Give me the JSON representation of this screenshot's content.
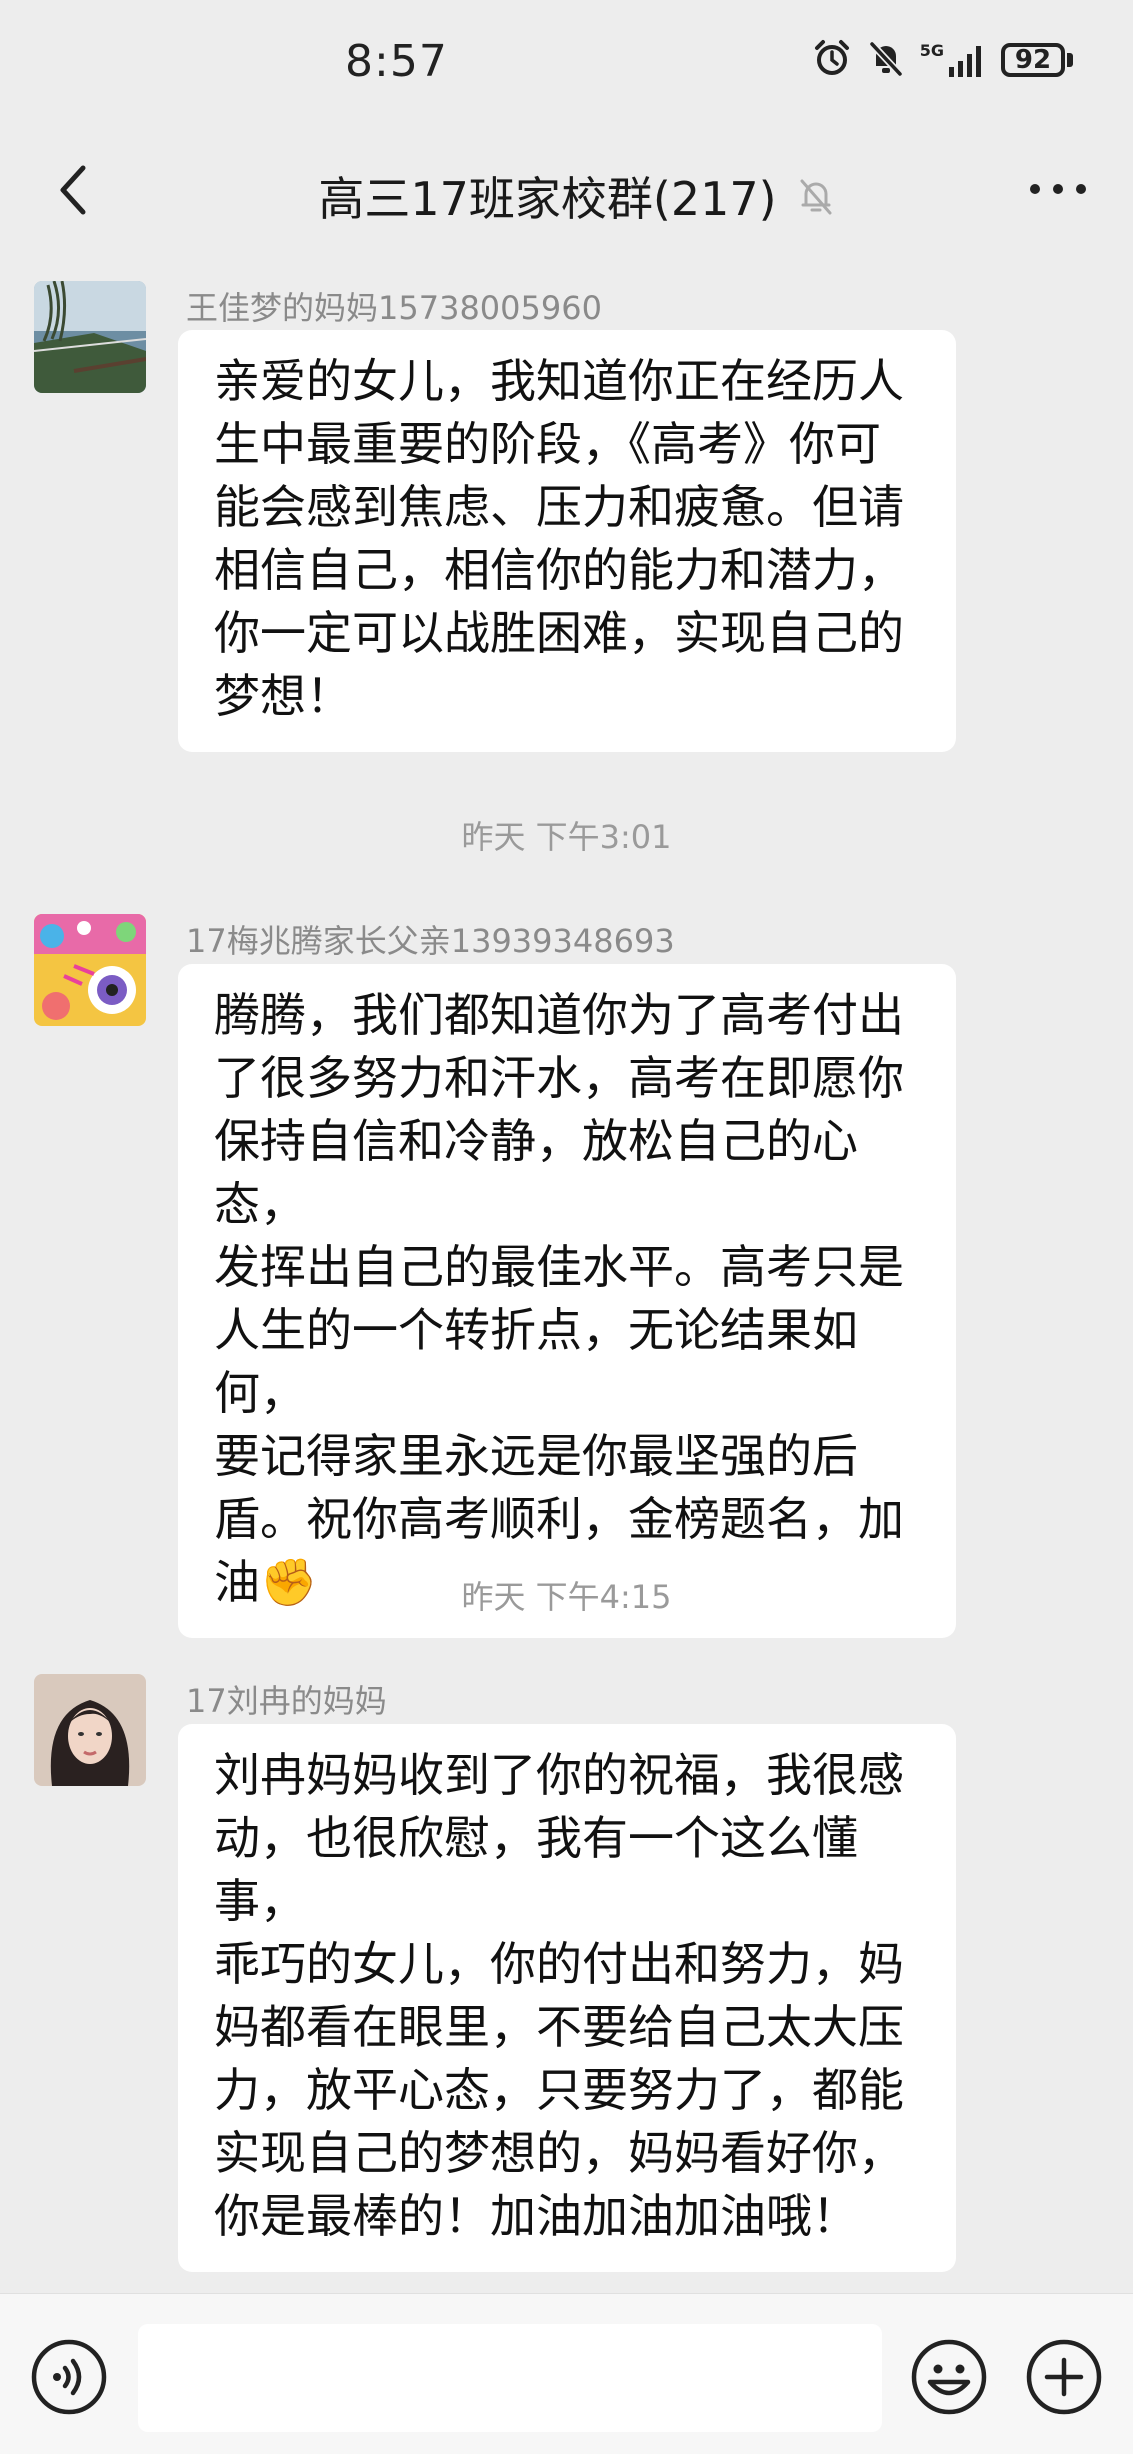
{
  "status_bar": {
    "time": "8:57",
    "network": "5G",
    "battery": "92"
  },
  "header": {
    "title": "高三17班家校群(217)"
  },
  "messages": [
    {
      "sender": "王佳梦的妈妈15738005960",
      "text": "亲爱的女儿，我知道你正在经历人\n生中最重要的阶段，《高考》你可\n能会感到焦虑、压力和疲惫。但请\n相信自己，相信你的能力和潜力，\n你一定可以战胜困难，实现自己的\n梦想！"
    },
    {
      "timestamp": "昨天 下午3:01"
    },
    {
      "sender": "17梅兆腾家长父亲13939348693",
      "text": "腾腾，我们都知道你为了高考付出\n了很多努力和汗水，高考在即愿你\n保持自信和冷静，放松自己的心态，\n发挥出自己的最佳水平。高考只是\n人生的一个转折点，无论结果如何，\n要记得家里永远是你最坚强的后\n盾。祝你高考顺利，金榜题名，加\n油✊"
    },
    {
      "timestamp": "昨天 下午4:15"
    },
    {
      "sender": "17刘冉的妈妈",
      "text": "刘冉妈妈收到了你的祝福，我很感\n动，也很欣慰，我有一个这么懂事，\n乖巧的女儿，你的付出和努力，妈\n妈都看在眼里，不要给自己太大压\n力，放平心态，只要努力了，都能\n实现自己的梦想的，妈妈看好你，\n你是最棒的！加油加油加油哦！"
    }
  ],
  "icons": {
    "back": "back-chevron-icon",
    "mute": "bell-muted-icon",
    "more": "more-dots-icon",
    "voice": "voice-icon",
    "emoji": "emoji-icon",
    "plus": "plus-icon"
  },
  "colors": {
    "background": "#ededed",
    "bubble": "#ffffff",
    "sender": "#8a8a8a",
    "timestamp": "#9a9a9a"
  }
}
